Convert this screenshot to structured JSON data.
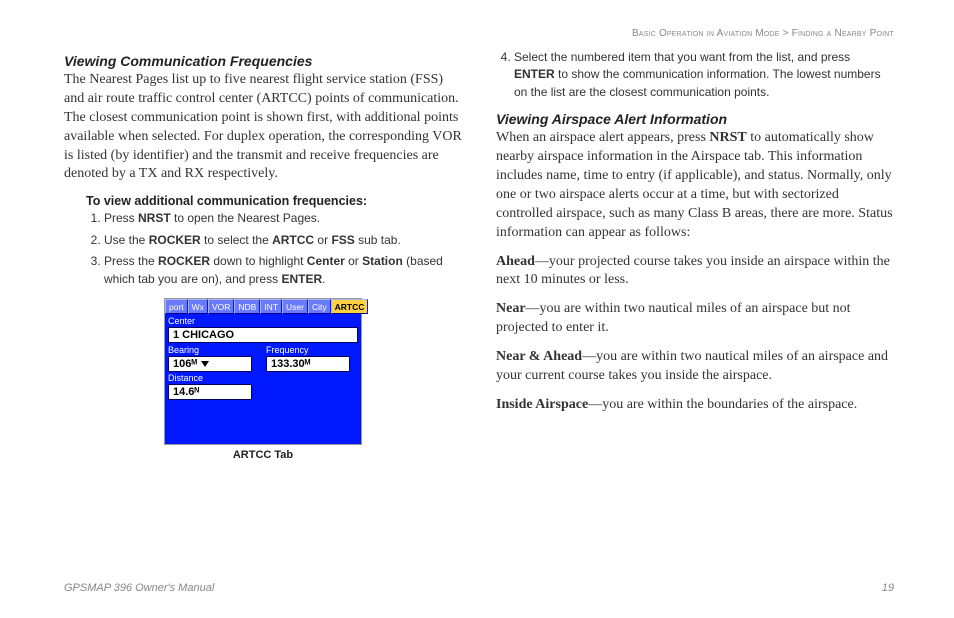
{
  "breadcrumb": {
    "section": "Basic Operation in Aviation Mode",
    "sep": ">",
    "sub": "Finding a Nearby Point"
  },
  "left": {
    "heading": "Viewing Communication Frequencies",
    "para": "The Nearest Pages list up to five nearest flight service station (FSS) and air route traffic control center (ARTCC) points of communication. The closest communication point is shown first, with additional points available when selected. For duplex operation, the corresponding VOR is listed (by identifier) and the transmit and receive frequencies are denoted by a TX and RX respectively.",
    "subhead": "To view additional communication frequencies:",
    "steps": [
      {
        "pre": "Press ",
        "b1": "NRST",
        "post": " to open the Nearest Pages."
      },
      {
        "pre": "Use the ",
        "b1": "ROCKER",
        "mid": " to select the ",
        "b2": "ARTCC",
        "mid2": " or ",
        "b3": "FSS",
        "post": " sub tab."
      },
      {
        "pre": "Press the ",
        "b1": "ROCKER",
        "mid": " down to highlight ",
        "b2": "Center",
        "mid2": " or ",
        "b3": "Station",
        "mid3": " (based which tab you are on), and press ",
        "b4": "ENTER",
        "post": "."
      }
    ],
    "screenshot": {
      "tabs": [
        "port",
        "Wx",
        "VOR",
        "NDB",
        "INT",
        "User",
        "City",
        "ARTCC"
      ],
      "center_label": "Center",
      "center_value": "1 CHICAGO",
      "bearing_label": "Bearing",
      "bearing_value": "106ᴹ",
      "frequency_label": "Frequency",
      "frequency_value": "133.30ᴹ",
      "distance_label": "Distance",
      "distance_value": "14.6ᴺ"
    },
    "caption": "ARTCC Tab"
  },
  "right": {
    "step4": {
      "num": "4.",
      "pre": "Select the numbered item that you want from the list, and press ",
      "b1": "ENTER",
      "post": " to show the communication information. The lowest numbers on the list are the closest communication points."
    },
    "heading": "Viewing Airspace Alert Information",
    "para_pre": "When an airspace alert appears, press ",
    "para_b": "NRST",
    "para_post": " to automatically show nearby airspace information in the Airspace tab. This information includes name, time to entry (if applicable), and status. Normally, only one or two airspace alerts occur at a time, but with sectorized controlled airspace, such as many Class B areas, there are more. Status information can appear as follows:",
    "statuses": [
      {
        "term": "Ahead",
        "desc": "—your projected course takes you inside an airspace within the next 10 minutes or less."
      },
      {
        "term": "Near",
        "desc": "—you are within two nautical miles of an airspace but not projected to enter it."
      },
      {
        "term": "Near & Ahead",
        "desc": "—you are within two nautical miles of an airspace and your current course takes you inside the airspace."
      },
      {
        "term": "Inside Airspace",
        "desc": "—you are within the boundaries of the airspace."
      }
    ]
  },
  "footer": {
    "left": "GPSMAP 396 Owner's Manual",
    "right": "19"
  }
}
